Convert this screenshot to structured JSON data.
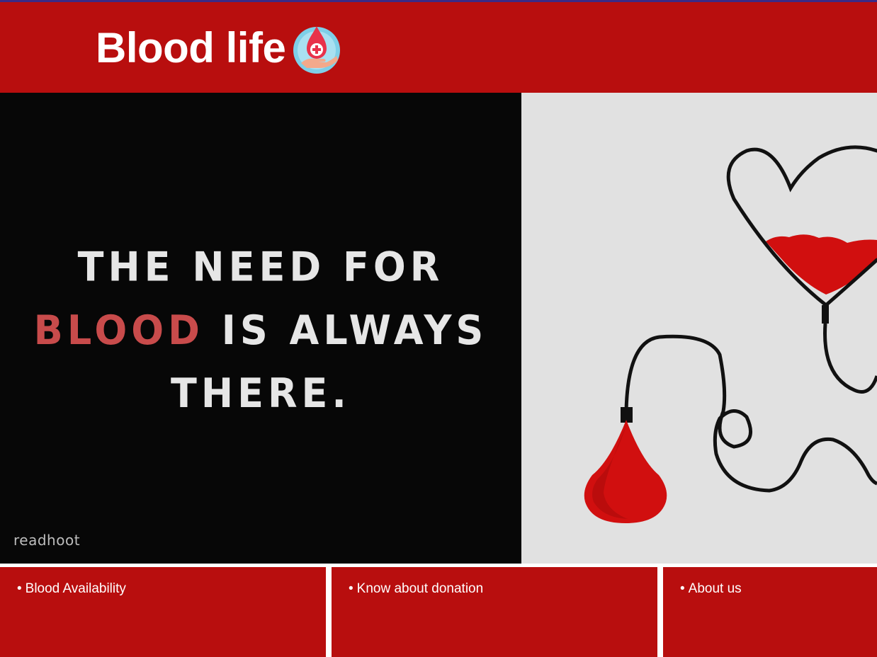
{
  "header": {
    "title": "Blood life",
    "logo_icon": "blood-drop-hand-icon"
  },
  "hero": {
    "line1": "THE NEED FOR",
    "line2_highlight": "BLOOD",
    "line2_rest": "IS ALWAYS",
    "line3": "THERE.",
    "credit": "readhoot",
    "illustration": "heart-blood-bag-icon"
  },
  "nav_cards": [
    {
      "label": "Blood Availability"
    },
    {
      "label": "Know about donation"
    },
    {
      "label": "About us"
    }
  ],
  "colors": {
    "brand_red": "#b80e0e",
    "highlight": "#c84b4b",
    "hero_dark": "#070707",
    "hero_light": "#e1e1e1"
  }
}
